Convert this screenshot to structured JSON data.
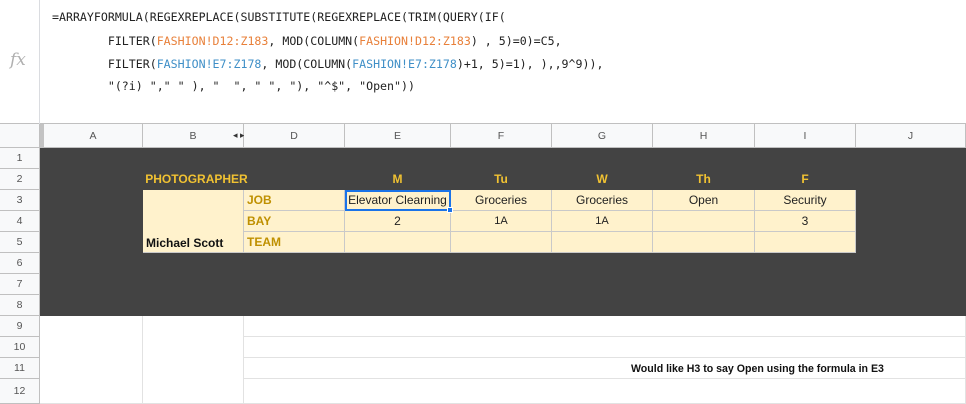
{
  "formula_bar": {
    "fx_label": "fx",
    "line1": "=ARRAYFORMULA(REGEXREPLACE(SUBSTITUTE(REGEXREPLACE(TRIM(QUERY(IF(",
    "line2_a": "        FILTER(",
    "line2_ref1": "FASHION!D12:Z183",
    "line2_b": ", MOD(COLUMN(",
    "line2_ref2": "FASHION!D12:Z183",
    "line2_c": ") , 5)=0)=C5,",
    "line3_a": "        FILTER(",
    "line3_ref1": "FASHION!E7:Z178",
    "line3_b": ", MOD(COLUMN(",
    "line3_ref2": "FASHION!E7:Z178",
    "line3_c": ")+1, 5)=1), ),,9^9)),",
    "line4": "        \"(?i) \",\" \" ), \"  \", \" \", \"), \"^$\", \"Open\"))"
  },
  "columns": [
    "A",
    "B",
    "D",
    "E",
    "F",
    "G",
    "H",
    "I",
    "J"
  ],
  "rows": [
    "1",
    "2",
    "3",
    "4",
    "5",
    "6",
    "7",
    "8",
    "9",
    "10",
    "11",
    "12"
  ],
  "sheet": {
    "photographer_label": "PHOTOGRAPHER",
    "days": [
      "M",
      "Tu",
      "W",
      "Th",
      "F"
    ],
    "job_label": "JOB",
    "bay_label": "BAY",
    "team_label": "TEAM",
    "name": "Michael Scott",
    "jobs": [
      "Elevator Clearning",
      "Groceries",
      "Groceries",
      "Open",
      "Security"
    ],
    "bays": [
      "2",
      "1A",
      "1A",
      "",
      "3"
    ],
    "teams": [
      "",
      "",
      "",
      "",
      ""
    ]
  },
  "note": "Would like H3 to say Open using the formula in E3",
  "colors": {
    "dark_fill": "#434343",
    "yellow_fill": "#fff2cc",
    "gold_text": "#f1c232",
    "label_text": "#bf9000",
    "selection": "#1a73e8"
  }
}
